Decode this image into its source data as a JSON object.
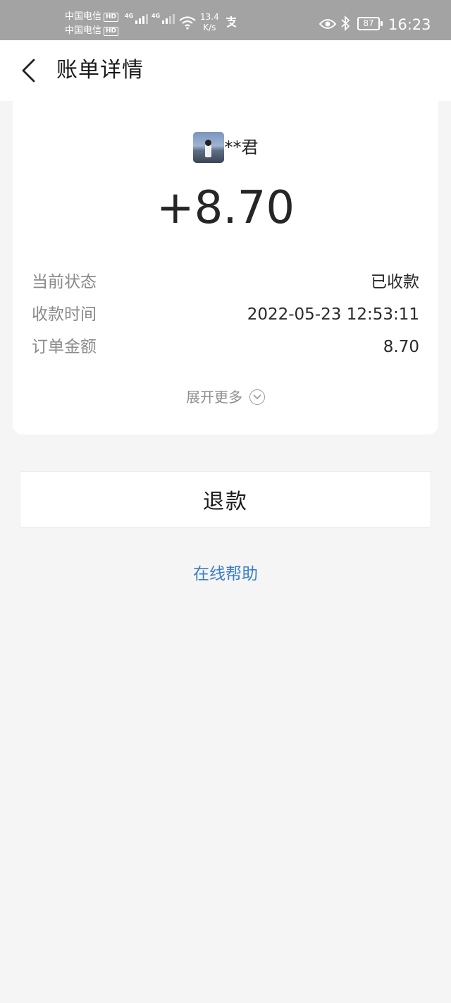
{
  "status_bar": {
    "carrier_1": "中国电信",
    "carrier_2": "中国电信",
    "hd_badge": "HD",
    "network_type": "4G",
    "net_speed_value": "13.4",
    "net_speed_unit": "K/s",
    "battery_level": "87",
    "time": "16:23",
    "icons": [
      "signal-icon",
      "wifi-icon",
      "alipay-icon",
      "eye-icon",
      "bluetooth-icon",
      "battery-icon"
    ]
  },
  "header": {
    "title": "账单详情"
  },
  "bill": {
    "payer_name": "**君",
    "amount": "+8.70",
    "details": [
      {
        "label": "当前状态",
        "value": "已收款"
      },
      {
        "label": "收款时间",
        "value": "2022-05-23 12:53:11"
      },
      {
        "label": "订单金额",
        "value": "8.70"
      }
    ],
    "expand_label": "展开更多"
  },
  "actions": {
    "refund_label": "退款",
    "help_label": "在线帮助"
  },
  "colors": {
    "status_bar_bg": "#a3a3a3",
    "page_bg": "#f5f5f5",
    "link_blue": "#3a7ec9"
  }
}
